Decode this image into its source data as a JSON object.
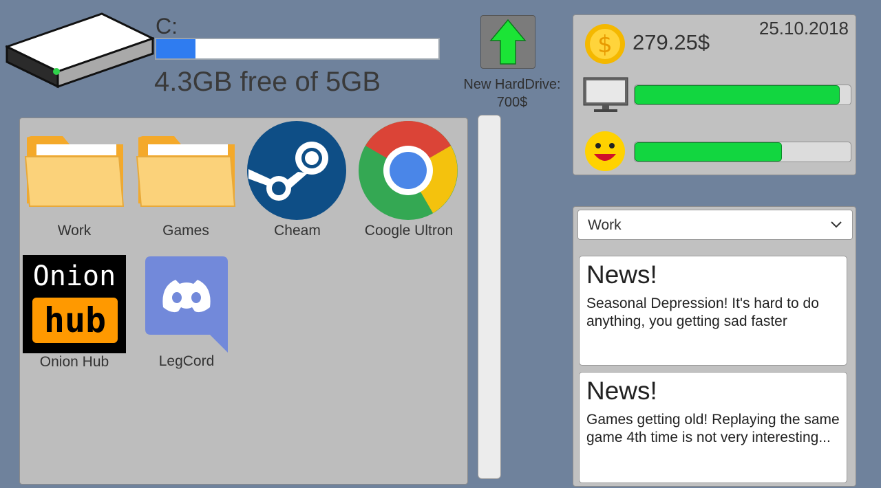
{
  "drive": {
    "letter": "C:",
    "free_text": "4.3GB free of 5GB",
    "used_fraction": 0.14,
    "bar_color": "#2f7cf0",
    "icon": "hard-drive-icon"
  },
  "upgrade": {
    "label": "New HardDrive:",
    "price": "700$",
    "icon": "up-arrow-icon",
    "arrow_color": "#1be436"
  },
  "desktop": {
    "apps": [
      {
        "label": "Work",
        "icon": "folder-icon"
      },
      {
        "label": "Games",
        "icon": "folder-icon"
      },
      {
        "label": "Cheam",
        "icon": "steam-icon"
      },
      {
        "label": "Coogle Ultron",
        "icon": "chrome-icon"
      },
      {
        "label": "Onion Hub",
        "icon": "onion-hub-icon",
        "logo_text_top": "Onion",
        "logo_text_bottom": "hub"
      },
      {
        "label": "LegCord",
        "icon": "discord-icon"
      }
    ]
  },
  "stats": {
    "date": "25.10.2018",
    "money": "279.25$",
    "computer_health": 0.95,
    "happiness": 0.68,
    "bar_color": "#12d640"
  },
  "news_panel": {
    "dropdown_value": "Work",
    "items": [
      {
        "title": "News!",
        "body": "Seasonal Depression! It's hard to do anything, you getting sad faster"
      },
      {
        "title": "News!",
        "body": "Games getting old! Replaying the same game 4th time is not very interesting..."
      }
    ]
  }
}
